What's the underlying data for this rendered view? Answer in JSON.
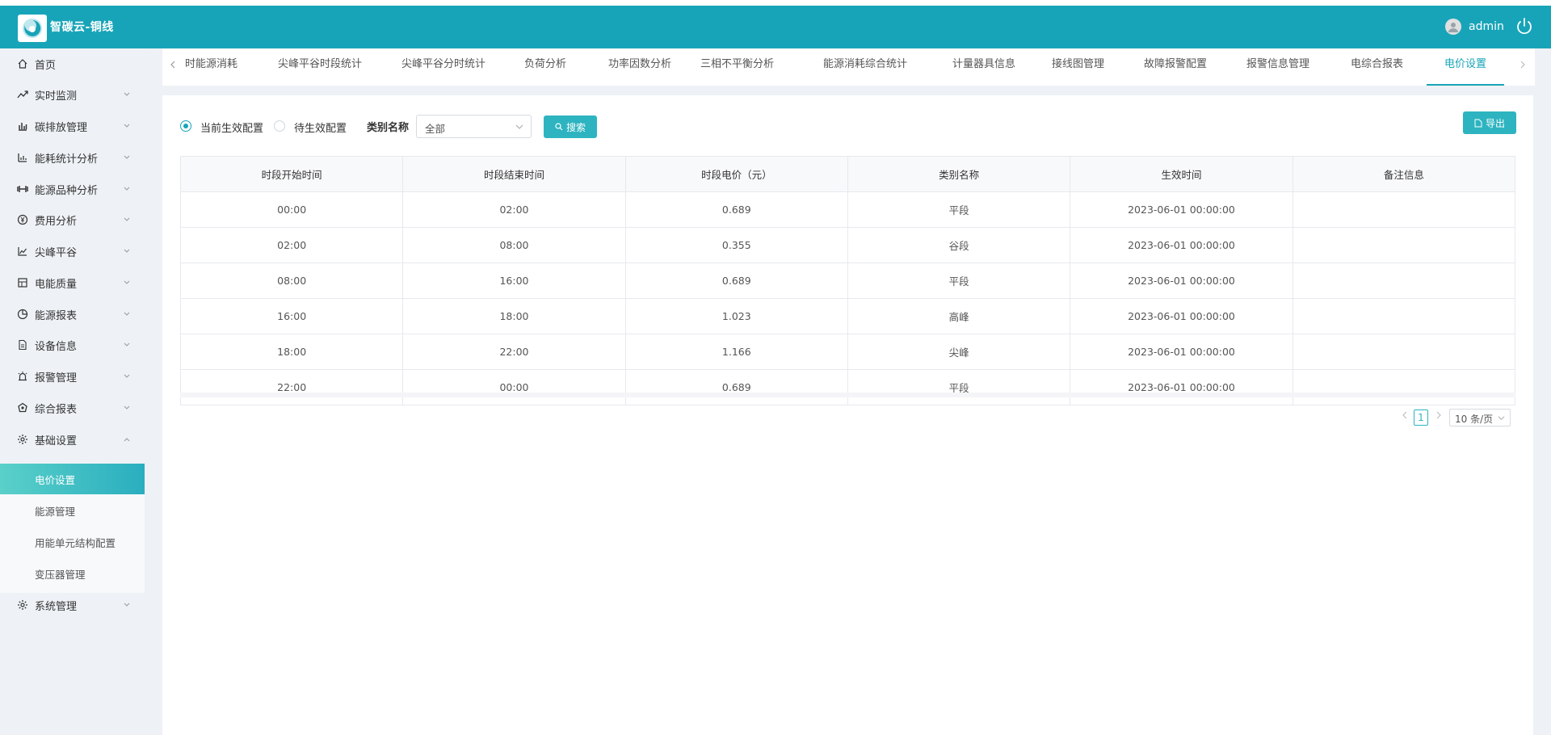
{
  "header": {
    "app_title": "智碳云-铜线",
    "username": "admin",
    "logo_icon": "swirl-logo-icon",
    "colors": {
      "header_bg": "#18a4b8",
      "accent": "#2db4c0"
    }
  },
  "sidebar": {
    "items": [
      {
        "label": "首页",
        "icon": "home-icon"
      },
      {
        "label": "实时监测",
        "icon": "trend-icon"
      },
      {
        "label": "碳排放管理",
        "icon": "bar-chart-icon"
      },
      {
        "label": "能耗统计分析",
        "icon": "stats-icon"
      },
      {
        "label": "能源品种分析",
        "icon": "weights-icon"
      },
      {
        "label": "费用分析",
        "icon": "yen-icon"
      },
      {
        "label": "尖峰平谷",
        "icon": "line-chart-icon"
      },
      {
        "label": "电能质量",
        "icon": "panel-icon"
      },
      {
        "label": "能源报表",
        "icon": "pie-icon"
      },
      {
        "label": "设备信息",
        "icon": "document-icon"
      },
      {
        "label": "报警管理",
        "icon": "alarm-icon"
      },
      {
        "label": "综合报表",
        "icon": "report-icon"
      },
      {
        "label": "基础设置",
        "icon": "gear-icon"
      }
    ],
    "sub_items": [
      {
        "label": "电价设置",
        "active": true
      },
      {
        "label": "能源管理"
      },
      {
        "label": "用能单元结构配置"
      },
      {
        "label": "变压器管理"
      }
    ],
    "last_item": {
      "label": "系统管理",
      "icon": "gear-icon"
    }
  },
  "tabs": [
    "时能源消耗",
    "尖峰平谷时段统计",
    "尖峰平谷分时统计",
    "负荷分析",
    "功率因数分析",
    "三相不平衡分析",
    "能源消耗综合统计",
    "计量器具信息",
    "接线图管理",
    "故障报警配置",
    "报警信息管理",
    "电综合报表",
    "电价设置"
  ],
  "filters": {
    "radio_current": "当前生效配置",
    "radio_pending": "待生效配置",
    "category_label": "类别名称",
    "category_value": "全部",
    "search_button": "搜索",
    "export_button": "导出"
  },
  "table": {
    "columns": [
      "时段开始时间",
      "时段结束时间",
      "时段电价（元）",
      "类别名称",
      "生效时间",
      "备注信息"
    ],
    "rows": [
      [
        "00:00",
        "02:00",
        "0.689",
        "平段",
        "2023-06-01 00:00:00",
        ""
      ],
      [
        "02:00",
        "08:00",
        "0.355",
        "谷段",
        "2023-06-01 00:00:00",
        ""
      ],
      [
        "08:00",
        "16:00",
        "0.689",
        "平段",
        "2023-06-01 00:00:00",
        ""
      ],
      [
        "16:00",
        "18:00",
        "1.023",
        "高峰",
        "2023-06-01 00:00:00",
        ""
      ],
      [
        "18:00",
        "22:00",
        "1.166",
        "尖峰",
        "2023-06-01 00:00:00",
        ""
      ],
      [
        "22:00",
        "00:00",
        "0.689",
        "平段",
        "2023-06-01 00:00:00",
        ""
      ]
    ]
  },
  "pagination": {
    "current_page": "1",
    "page_size": "10 条/页"
  }
}
